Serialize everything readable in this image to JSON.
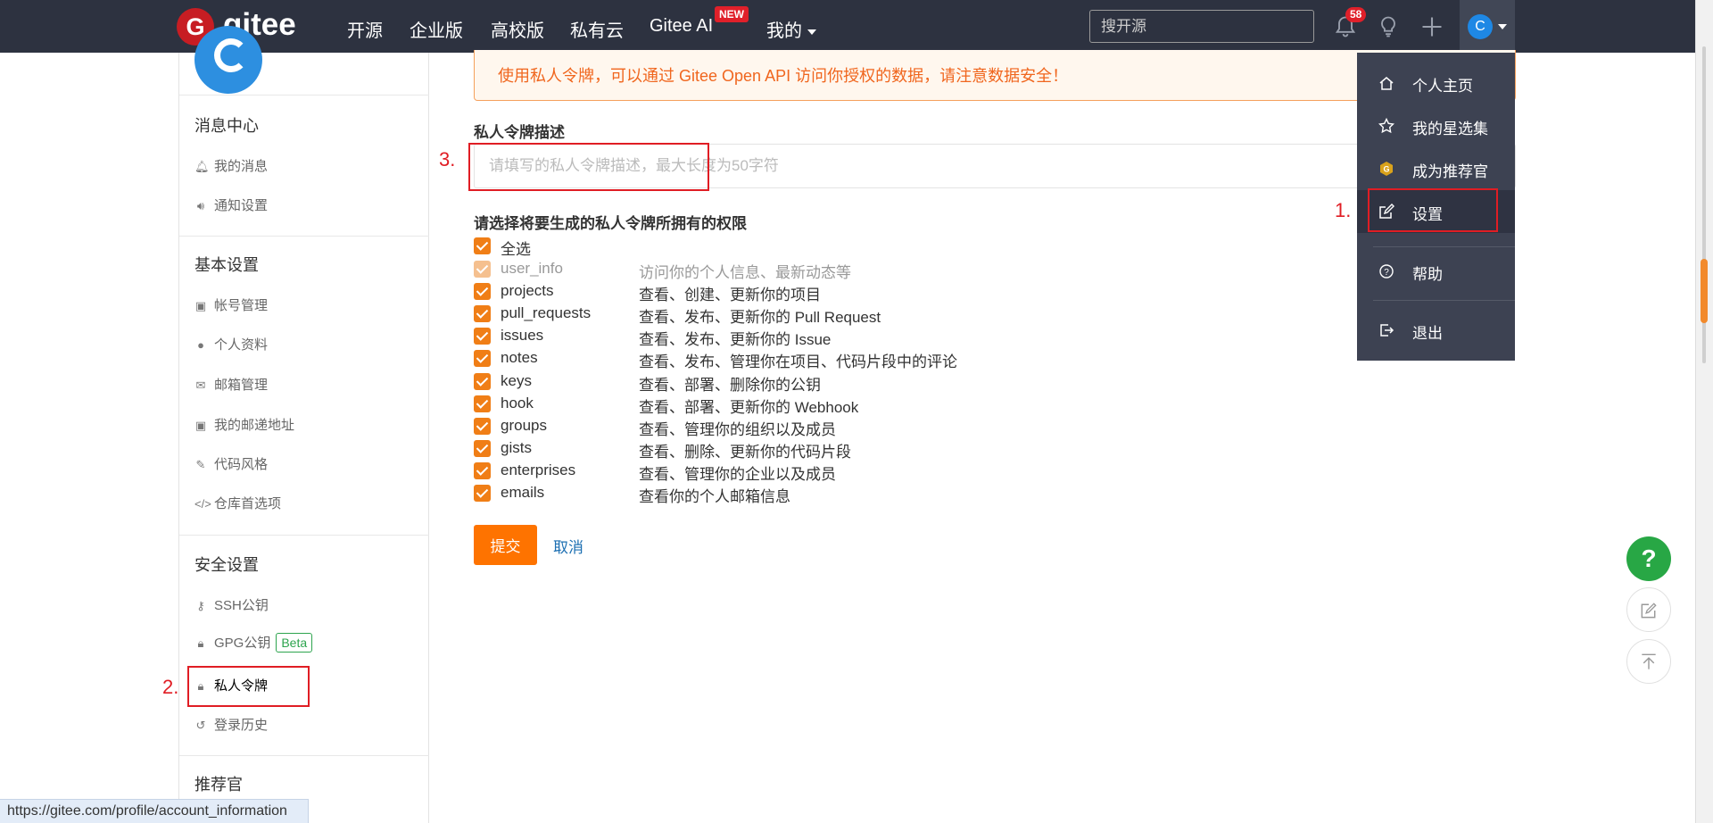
{
  "nav": {
    "logo_letter": "G",
    "logo_text": "gitee",
    "links": [
      "开源",
      "企业版",
      "高校版",
      "私有云",
      "Gitee AI",
      "我的"
    ],
    "new_badge": "NEW",
    "search_placeholder": "搜开源",
    "notification_count": "58",
    "user_initial": "C"
  },
  "sidebar": {
    "sections": [
      {
        "title": "消息中心",
        "items": [
          {
            "icon": "bell-icon",
            "label": "我的消息"
          },
          {
            "icon": "speaker-icon",
            "label": "通知设置"
          }
        ]
      },
      {
        "title": "基本设置",
        "items": [
          {
            "icon": "id-card-icon",
            "label": "帐号管理"
          },
          {
            "icon": "user-icon",
            "label": "个人资料"
          },
          {
            "icon": "envelope-icon",
            "label": "邮箱管理"
          },
          {
            "icon": "address-card-icon",
            "label": "我的邮递地址"
          },
          {
            "icon": "brush-icon",
            "label": "代码风格"
          },
          {
            "icon": "code-icon",
            "label": "仓库首选项"
          }
        ]
      },
      {
        "title": "安全设置",
        "items": [
          {
            "icon": "key-icon",
            "label": "SSH公钥"
          },
          {
            "icon": "lock-icon",
            "label": "GPG公钥",
            "badge": "Beta"
          },
          {
            "icon": "token-lock-icon",
            "label": "私人令牌",
            "active": true
          },
          {
            "icon": "history-icon",
            "label": "登录历史"
          }
        ]
      },
      {
        "title": "推荐官",
        "items": []
      }
    ]
  },
  "main": {
    "notice": "使用私人令牌，可以通过 Gitee Open API 访问你授权的数据，请注意数据安全！",
    "desc_label": "私人令牌描述",
    "desc_placeholder": "请填写的私人令牌描述，最大长度为50字符",
    "perm_label": "请选择将要生成的私人令牌所拥有的权限",
    "select_all": "全选",
    "permissions": [
      {
        "name": "user_info",
        "desc": "访问你的个人信息、最新动态等",
        "disabled": true
      },
      {
        "name": "projects",
        "desc": "查看、创建、更新你的项目"
      },
      {
        "name": "pull_requests",
        "desc": "查看、发布、更新你的 Pull Request"
      },
      {
        "name": "issues",
        "desc": "查看、发布、更新你的 Issue"
      },
      {
        "name": "notes",
        "desc": "查看、发布、管理你在项目、代码片段中的评论"
      },
      {
        "name": "keys",
        "desc": "查看、部署、删除你的公钥"
      },
      {
        "name": "hook",
        "desc": "查看、部署、更新你的 Webhook"
      },
      {
        "name": "groups",
        "desc": "查看、管理你的组织以及成员"
      },
      {
        "name": "gists",
        "desc": "查看、删除、更新你的代码片段"
      },
      {
        "name": "enterprises",
        "desc": "查看、管理你的企业以及成员"
      },
      {
        "name": "emails",
        "desc": "查看你的个人邮箱信息"
      }
    ],
    "submit": "提交",
    "cancel": "取消"
  },
  "dropdown": {
    "items": [
      {
        "icon": "home-icon",
        "label": "个人主页"
      },
      {
        "icon": "star-icon",
        "label": "我的星选集"
      },
      {
        "icon": "recommender-badge-icon",
        "label": "成为推荐官"
      },
      {
        "icon": "edit-icon",
        "label": "设置",
        "active": true
      },
      {
        "icon": "help-circle-icon",
        "label": "帮助"
      },
      {
        "icon": "logout-icon",
        "label": "退出"
      }
    ]
  },
  "annotations": [
    "1.",
    "2.",
    "3."
  ],
  "fab": {
    "help": "?"
  },
  "statusbar": {
    "url": "https://gitee.com/profile/account_information"
  },
  "colors": {
    "nav_bg": "#2d3240",
    "accent_orange": "#fe7300",
    "checkbox": "#f07e16",
    "annotation_red": "#e01d24",
    "help_green": "#28a745"
  }
}
